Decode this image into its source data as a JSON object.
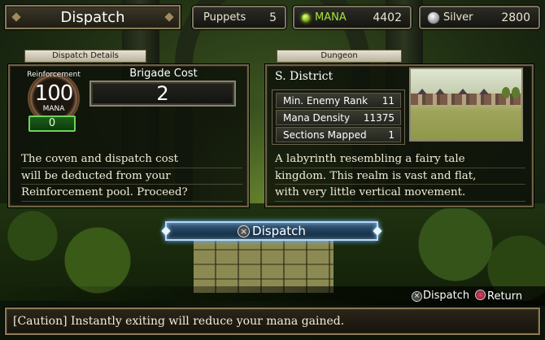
{
  "screen_title": "Dispatch",
  "resources": {
    "puppets": {
      "label": "Puppets",
      "value": "5"
    },
    "mana": {
      "label": "MANA",
      "value": "4402",
      "icon": "mana-orb-icon",
      "color": "#a6e53a"
    },
    "silver": {
      "label": "Silver",
      "value": "2800",
      "icon": "silver-coin-icon"
    }
  },
  "details": {
    "tab": "Dispatch Details",
    "emblem_top": "Reinforcement",
    "emblem_value": "100",
    "emblem_unit": "MANA",
    "reinforcement_field": "0",
    "brigade_cost_label": "Brigade Cost",
    "brigade_cost_value": "2",
    "message_lines": [
      "The coven and dispatch cost",
      "will be deducted from your",
      "Reinforcement pool. Proceed?"
    ]
  },
  "dungeon": {
    "tab": "Dungeon",
    "name": "S. District",
    "stats": [
      {
        "label": "Min. Enemy Rank",
        "value": "11"
      },
      {
        "label": "Mana Density",
        "value": "11375"
      },
      {
        "label": "Sections Mapped",
        "value": "1"
      }
    ],
    "description_lines": [
      "A labyrinth resembling a fairy tale",
      "kingdom. This realm is vast and flat,",
      "with very little vertical movement."
    ]
  },
  "dispatch_button": {
    "label": "Dispatch",
    "glyph": "×",
    "accent": "#b8d9ff"
  },
  "hints": {
    "dispatch": "Dispatch",
    "dispatch_glyph": "×",
    "return": "Return"
  },
  "caution": "[Caution] Instantly exiting will reduce your mana gained."
}
